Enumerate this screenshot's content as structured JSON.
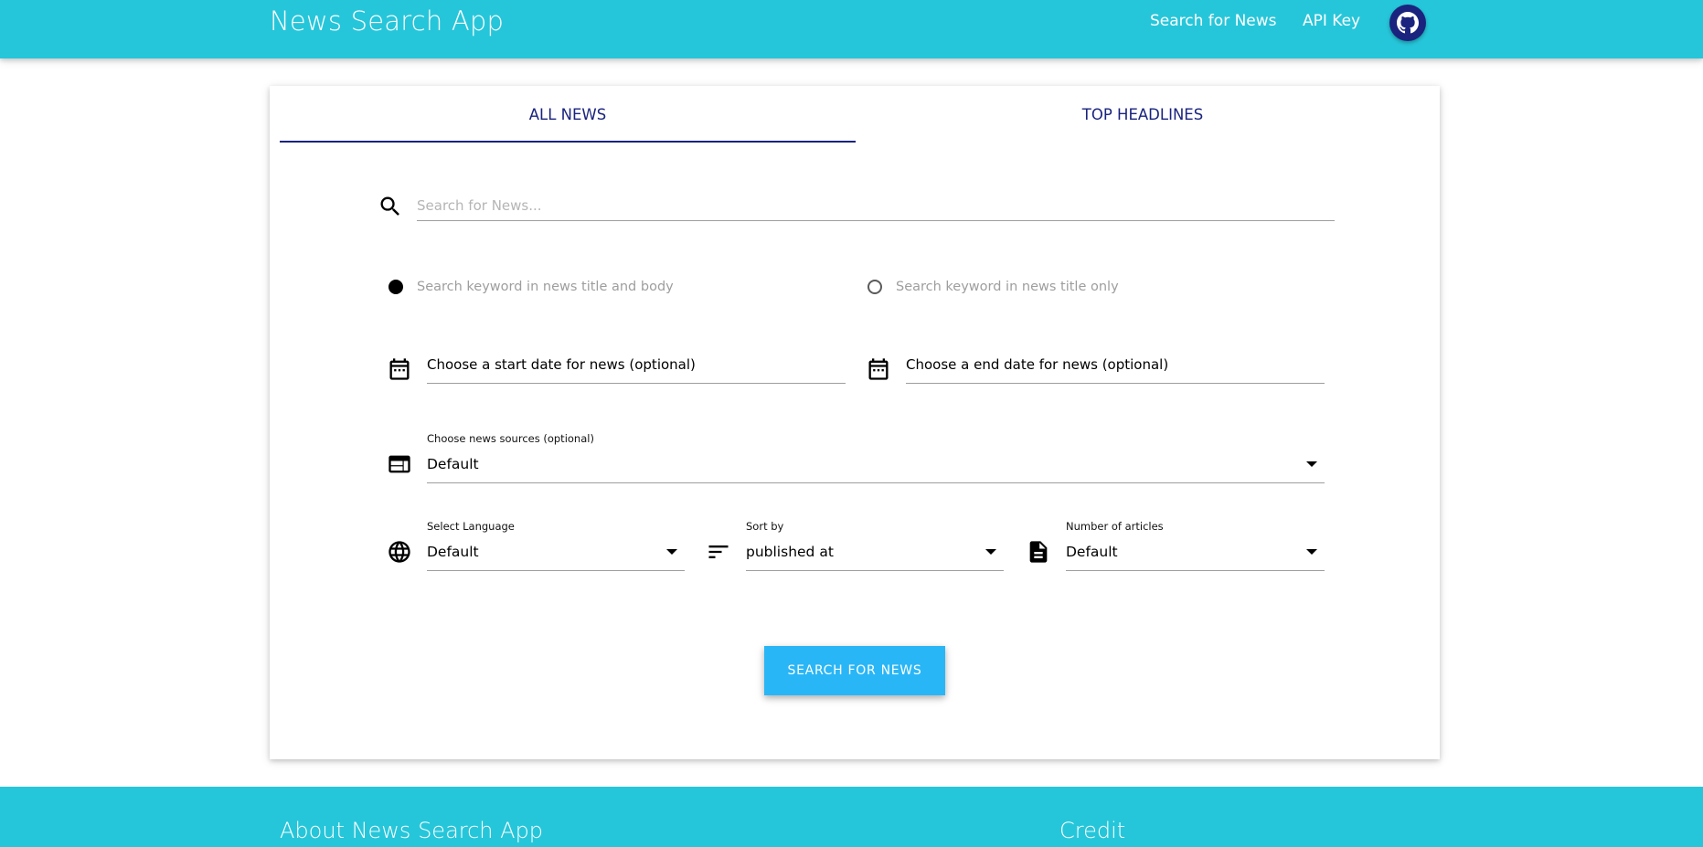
{
  "navbar": {
    "brand": "News Search App",
    "links": [
      "Search for News",
      "API Key"
    ],
    "github_icon": "github-icon",
    "bg_color": "#26c6da"
  },
  "tabs": [
    {
      "label": "ALL NEWS",
      "active": true
    },
    {
      "label": "TOP HEADLINES",
      "active": false
    }
  ],
  "search": {
    "placeholder": "Search for News...",
    "value": "",
    "icon": "search-icon"
  },
  "radios": [
    {
      "label": "Search keyword in news title and body",
      "checked": true
    },
    {
      "label": "Search keyword in news title only",
      "checked": false
    }
  ],
  "dates": {
    "start_label": "Choose a start date for news (optional)",
    "end_label": "Choose a end date for news (optional)",
    "icon": "calendar-icon"
  },
  "sources": {
    "label": "Choose news sources (optional)",
    "value": "Default",
    "icon": "web-icon"
  },
  "language": {
    "label": "Select Language",
    "value": "Default",
    "icon": "globe-icon"
  },
  "sort": {
    "label": "Sort by",
    "value": "published at",
    "icon": "sort-icon"
  },
  "articles": {
    "label": "Number of articles",
    "value": "Default",
    "icon": "document-icon"
  },
  "button": {
    "label": "SEARCH FOR NEWS",
    "color": "#29b6f6"
  },
  "footer": {
    "about_title": "About News Search App",
    "credit_title": "Credit"
  },
  "colors": {
    "accent": "#1a237e",
    "primary": "#26c6da"
  }
}
